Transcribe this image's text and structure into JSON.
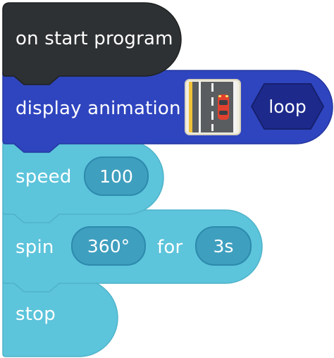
{
  "blocks": {
    "start": {
      "label": "on start program",
      "color": "#2e3133"
    },
    "display": {
      "label": "display animation",
      "color": "#2f45bf",
      "animation_thumbnail": "road-car-animation",
      "mode": "loop"
    },
    "speed": {
      "label": "speed",
      "value": "100",
      "color": "#5cc4db"
    },
    "spin": {
      "label": "spin",
      "angle": "360°",
      "for_label": "for",
      "duration": "3s",
      "color": "#5cc4db"
    },
    "stop": {
      "label": "stop",
      "color": "#5cc4db"
    }
  }
}
